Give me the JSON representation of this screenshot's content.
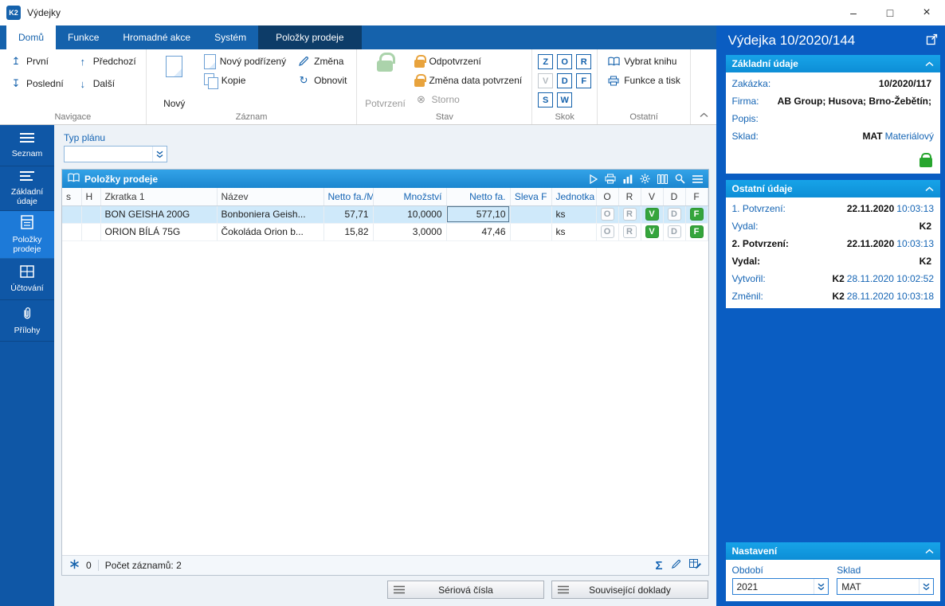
{
  "icons": {
    "first": "↥",
    "last": "↧",
    "prev": "↑",
    "next": "↓",
    "refresh": "↻",
    "storno": "⊗",
    "sigma": "Σ",
    "minimize": "–",
    "maximize": "□",
    "close": "×"
  },
  "titlebar": {
    "app_logo": "K2",
    "title": "Výdejky"
  },
  "ribbon": {
    "tabs": [
      {
        "label": "Domů"
      },
      {
        "label": "Funkce"
      },
      {
        "label": "Hromadné akce"
      },
      {
        "label": "Systém"
      },
      {
        "label": "Položky prodeje"
      }
    ],
    "groups": {
      "navigace": {
        "label": "Navigace",
        "prvni": "První",
        "posledni": "Poslední",
        "predchozi": "Předchozí",
        "dalsi": "Další"
      },
      "zaznam": {
        "label": "Záznam",
        "novy": "Nový",
        "novy_podrizeny": "Nový podřízený",
        "kopie": "Kopie",
        "zmena": "Změna",
        "obnovit": "Obnovit"
      },
      "stav": {
        "label": "Stav",
        "potvrzeni": "Potvrzení",
        "odpotvrzeni": "Odpotvrzení",
        "zmena_data": "Změna data potvrzení",
        "storno": "Storno"
      },
      "skok": {
        "label": "Skok",
        "letters": [
          "Z",
          "O",
          "R",
          "V",
          "D",
          "F",
          "S",
          "W"
        ]
      },
      "ostatni": {
        "label": "Ostatní",
        "vybrat_knihu": "Vybrat knihu",
        "funkce_a_tisk": "Funkce a tisk"
      }
    }
  },
  "sidebar": {
    "items": [
      {
        "label": "Seznam"
      },
      {
        "label": "Základní údaje"
      },
      {
        "label": "Položky prodeje"
      },
      {
        "label": "Účtování"
      },
      {
        "label": "Přílohy"
      }
    ]
  },
  "main": {
    "typ_planu": {
      "label": "Typ plánu",
      "value": ""
    },
    "panel": {
      "title": "Položky prodeje",
      "columns": [
        "s",
        "H",
        "Zkratka 1",
        "Název",
        "Netto fa./M",
        "Množství",
        "Netto fa.",
        "Sleva F",
        "Jednotka",
        "O",
        "R",
        "V",
        "D",
        "F"
      ],
      "rows": [
        {
          "zkratka": "BON GEISHA 200G",
          "nazev": "Bonboniera Geish...",
          "netto_m": "57,71",
          "mnozstvi": "10,0000",
          "netto": "577,10",
          "sleva": "",
          "jednotka": "ks",
          "o": "O",
          "r": "R",
          "v": "V",
          "d": "D",
          "f": "F"
        },
        {
          "zkratka": "ORION BÍLÁ 75G",
          "nazev": "Čokoláda Orion b...",
          "netto_m": "15,82",
          "mnozstvi": "3,0000",
          "netto": "47,46",
          "sleva": "",
          "jednotka": "ks",
          "o": "O",
          "r": "R",
          "v": "V",
          "d": "D",
          "f": "F"
        }
      ],
      "status": {
        "marker_count": "0",
        "records": "Počet záznamů: 2"
      }
    },
    "footer_buttons": {
      "seriova_cisla": "Sériová čísla",
      "souvisejici_doklady": "Související doklady"
    }
  },
  "right_panel": {
    "title": "Výdejka 10/2020/144",
    "zakladni_udaje": {
      "title": "Základní údaje",
      "fields": [
        {
          "label": "Zakázka:",
          "value": "10/2020/117",
          "value2": ""
        },
        {
          "label": "Firma:",
          "value": "AB Group; Husova; Brno-Žebětín;",
          "value2": ""
        },
        {
          "label": "Popis:",
          "value": "",
          "value2": ""
        },
        {
          "label": "Sklad:",
          "value": "MAT",
          "value2": "Materiálový"
        }
      ]
    },
    "ostatni_udaje": {
      "title": "Ostatní údaje",
      "fields": [
        {
          "label": "1. Potvrzení:",
          "value": "22.11.2020",
          "value2": "10:03:13"
        },
        {
          "label": "Vydal:",
          "value": "K2",
          "value2": ""
        },
        {
          "label": "2. Potvrzení:",
          "value": "22.11.2020",
          "value2": "10:03:13"
        },
        {
          "label": "Vydal:",
          "value": "K2",
          "value2": ""
        },
        {
          "label": "Vytvořil:",
          "value": "K2",
          "value2": "28.11.2020 10:02:52"
        },
        {
          "label": "Změnil:",
          "value": "K2",
          "value2": "28.11.2020 10:03:18"
        }
      ]
    },
    "nastaveni": {
      "title": "Nastavení",
      "obdobi_label": "Období",
      "obdobi_value": "2021",
      "sklad_label": "Sklad",
      "sklad_value": "MAT"
    }
  }
}
